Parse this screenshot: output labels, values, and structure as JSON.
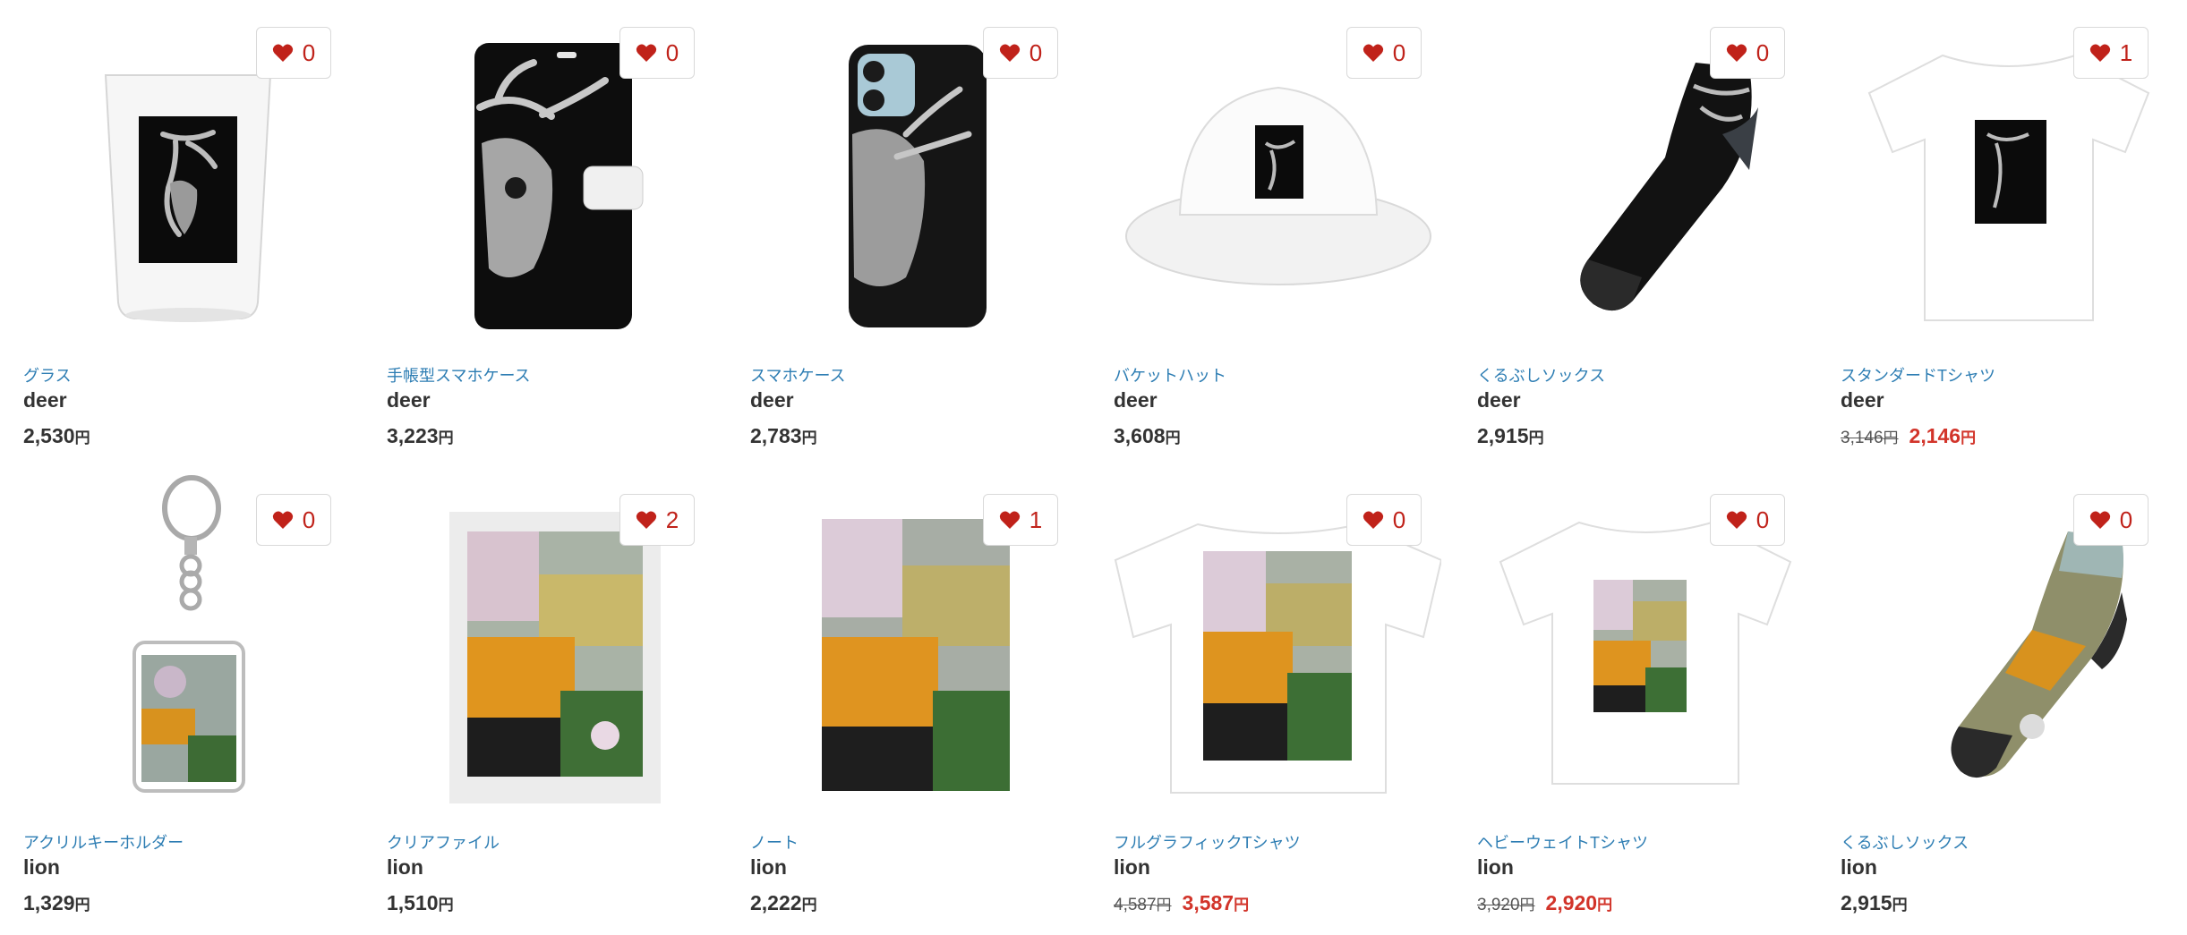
{
  "colors": {
    "accent_red": "#c0221a",
    "sale_red": "#d2342a",
    "category_blue": "#2d7db3",
    "text_dark": "#333333"
  },
  "products": [
    {
      "category": "グラス",
      "name": "deer",
      "price": "2,530",
      "yen": "円",
      "old_price": "",
      "likes": "0",
      "artwork": "deer",
      "item_icon": "glass-icon"
    },
    {
      "category": "手帳型スマホケース",
      "name": "deer",
      "price": "3,223",
      "yen": "円",
      "old_price": "",
      "likes": "0",
      "artwork": "deer",
      "item_icon": "notebook-phone-case-icon"
    },
    {
      "category": "スマホケース",
      "name": "deer",
      "price": "2,783",
      "yen": "円",
      "old_price": "",
      "likes": "0",
      "artwork": "deer",
      "item_icon": "phone-case-icon"
    },
    {
      "category": "バケットハット",
      "name": "deer",
      "price": "3,608",
      "yen": "円",
      "old_price": "",
      "likes": "0",
      "artwork": "deer",
      "item_icon": "bucket-hat-icon"
    },
    {
      "category": "くるぶしソックス",
      "name": "deer",
      "price": "2,915",
      "yen": "円",
      "old_price": "",
      "likes": "0",
      "artwork": "deer",
      "item_icon": "ankle-socks-icon"
    },
    {
      "category": "スタンダードTシャツ",
      "name": "deer",
      "price": "2,146",
      "yen": "円",
      "old_price": "3,146",
      "likes": "1",
      "artwork": "deer",
      "item_icon": "tshirt-icon"
    },
    {
      "category": "アクリルキーホルダー",
      "name": "lion",
      "price": "1,329",
      "yen": "円",
      "old_price": "",
      "likes": "0",
      "artwork": "lion",
      "item_icon": "keychain-icon"
    },
    {
      "category": "クリアファイル",
      "name": "lion",
      "price": "1,510",
      "yen": "円",
      "old_price": "",
      "likes": "2",
      "artwork": "lion",
      "item_icon": "clear-file-icon"
    },
    {
      "category": "ノート",
      "name": "lion",
      "price": "2,222",
      "yen": "円",
      "old_price": "",
      "likes": "1",
      "artwork": "lion",
      "item_icon": "notebook-icon"
    },
    {
      "category": "フルグラフィックTシャツ",
      "name": "lion",
      "price": "3,587",
      "yen": "円",
      "old_price": "4,587",
      "likes": "0",
      "artwork": "lion",
      "item_icon": "full-graphic-tshirt-icon"
    },
    {
      "category": "ヘビーウェイトTシャツ",
      "name": "lion",
      "price": "2,920",
      "yen": "円",
      "old_price": "3,920",
      "likes": "0",
      "artwork": "lion",
      "item_icon": "heavyweight-tshirt-icon"
    },
    {
      "category": "くるぶしソックス",
      "name": "lion",
      "price": "2,915",
      "yen": "円",
      "old_price": "",
      "likes": "0",
      "artwork": "lion",
      "item_icon": "ankle-socks-icon"
    }
  ]
}
